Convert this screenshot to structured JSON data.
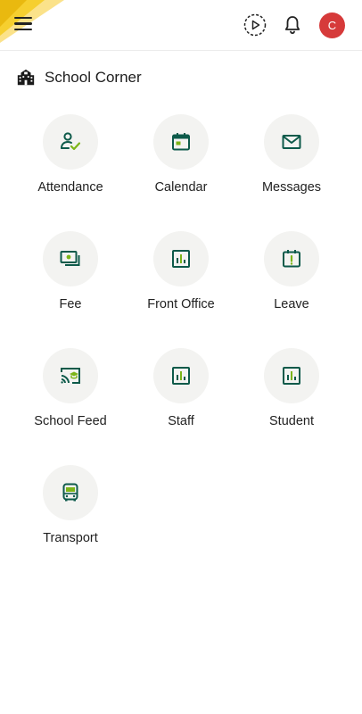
{
  "header": {
    "menu_icon": "hamburger-icon",
    "play_icon": "play-circle-icon",
    "bell_icon": "bell-icon",
    "avatar_initial": "C",
    "avatar_color": "#d63a3a"
  },
  "section": {
    "icon": "school-building-icon",
    "title": "School Corner"
  },
  "colors": {
    "icon_primary": "#0d5a4a",
    "icon_accent": "#7cb518",
    "tile_bg": "#f3f3f1"
  },
  "tiles": [
    {
      "label": "Attendance",
      "icon": "user-check-icon"
    },
    {
      "label": "Calendar",
      "icon": "calendar-icon"
    },
    {
      "label": "Messages",
      "icon": "envelope-icon"
    },
    {
      "label": "Fee",
      "icon": "money-icon"
    },
    {
      "label": "Front Office",
      "icon": "bar-chart-icon"
    },
    {
      "label": "Leave",
      "icon": "calendar-alert-icon"
    },
    {
      "label": "School Feed",
      "icon": "cast-graduation-icon"
    },
    {
      "label": "Staff",
      "icon": "bar-chart-icon"
    },
    {
      "label": "Student",
      "icon": "bar-chart-icon"
    },
    {
      "label": "Transport",
      "icon": "bus-icon"
    }
  ]
}
